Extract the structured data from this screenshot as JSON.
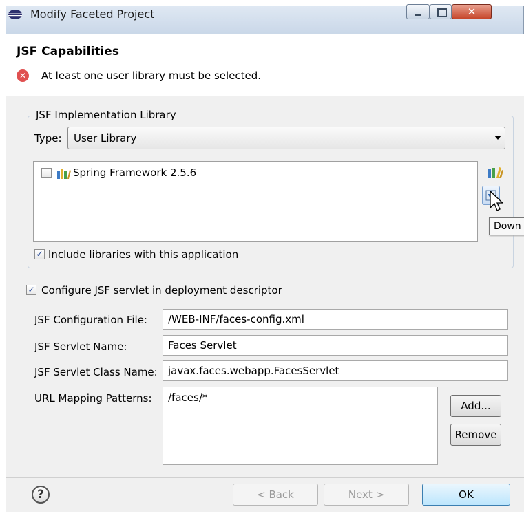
{
  "window": {
    "title": "Modify Faceted Project"
  },
  "header": {
    "title": "JSF Capabilities",
    "error": "At least one user library must be selected."
  },
  "impl": {
    "group_title": "JSF Implementation Library",
    "type_label": "Type:",
    "type_value": "User Library",
    "libraries": [
      {
        "name": "Spring Framework 2.5.6",
        "checked": false
      }
    ],
    "tooltip": "Down",
    "include_label": "Include libraries with this application",
    "include_checked": true
  },
  "servlet": {
    "configure_label": "Configure JSF servlet in deployment descriptor",
    "configure_checked": true,
    "config_file_label": "JSF Configuration File:",
    "config_file_value": "/WEB-INF/faces-config.xml",
    "servlet_name_label": "JSF Servlet Name:",
    "servlet_name_value": "Faces Servlet",
    "class_name_label": "JSF Servlet Class Name:",
    "class_name_value": "javax.faces.webapp.FacesServlet",
    "url_label": "URL Mapping Patterns:",
    "url_patterns": [
      "/faces/*"
    ],
    "add_label": "Add...",
    "remove_label": "Remove"
  },
  "footer": {
    "help": "?",
    "back_label": "< Back",
    "next_label": "Next >",
    "ok_label": "OK"
  },
  "icons": {
    "app": "eclipse-icon",
    "error": "error-icon",
    "library": "library-icon",
    "add_library": "add-library-icon",
    "download": "download-library-icon",
    "help": "help-icon",
    "cursor": "mouse-cursor-icon"
  },
  "colors": {
    "error": "#e05050",
    "ok_border": "#3c7fb1",
    "close": "#c6462b"
  }
}
